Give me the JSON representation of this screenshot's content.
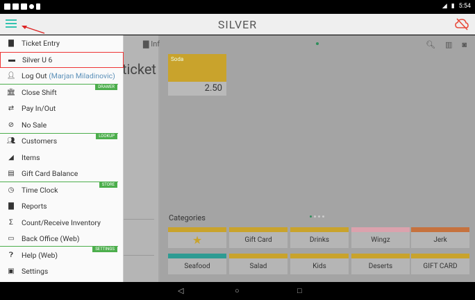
{
  "status": {
    "time": "5:54"
  },
  "app": {
    "logo": "SILVER"
  },
  "info_label": "Info",
  "ticket_word": "ticket",
  "product": {
    "name": "Soda",
    "price": "2.50"
  },
  "categories_label": "Categories",
  "categories": [
    {
      "label": "",
      "color": "#c9a32c",
      "star": true
    },
    {
      "label": "Gift Card",
      "color": "#c9a32c"
    },
    {
      "label": "Drinks",
      "color": "#c9a32c"
    },
    {
      "label": "Wingz",
      "color": "#dba2ad"
    },
    {
      "label": "Jerk",
      "color": "#c6723e"
    },
    {
      "label": "Seafood",
      "color": "#2e9b93"
    },
    {
      "label": "Salad",
      "color": "#c9a32c"
    },
    {
      "label": "Kids",
      "color": "#c9a32c"
    },
    {
      "label": "Deserts",
      "color": "#c9a32c"
    },
    {
      "label": "GIFT CARD",
      "color": "#c9a32c"
    }
  ],
  "menu": {
    "items": [
      {
        "label": "Ticket Entry",
        "icon": "document-icon"
      },
      {
        "label": "Silver U 6",
        "icon": "store-icon"
      },
      {
        "label": "Log Out",
        "sub": "(Marjan Miladinovic)",
        "icon": "person-icon"
      },
      {
        "label": "Close Shift",
        "icon": "bank-icon"
      },
      {
        "label": "Pay In/Out",
        "icon": "swap-icon"
      },
      {
        "label": "No Sale",
        "icon": "block-icon"
      },
      {
        "label": "Customers",
        "icon": "people-icon"
      },
      {
        "label": "Items",
        "icon": "items-icon"
      },
      {
        "label": "Gift Card Balance",
        "icon": "giftcard-icon"
      },
      {
        "label": "Time Clock",
        "icon": "clock-icon"
      },
      {
        "label": "Reports",
        "icon": "report-icon"
      },
      {
        "label": "Count/Receive Inventory",
        "icon": "sigma-icon"
      },
      {
        "label": "Back Office (Web)",
        "icon": "monitor-icon"
      },
      {
        "label": "Help (Web)",
        "icon": "help-icon"
      },
      {
        "label": "Settings",
        "icon": "settings-icon"
      }
    ],
    "sections": {
      "drawer": "DRAWER",
      "lookup": "LOOKUP",
      "store": "STORE",
      "settings": "SETTINGS"
    }
  },
  "colors": {
    "accent": "#33c3b0",
    "green": "#4cae4c",
    "selected_border": "#e33333"
  }
}
